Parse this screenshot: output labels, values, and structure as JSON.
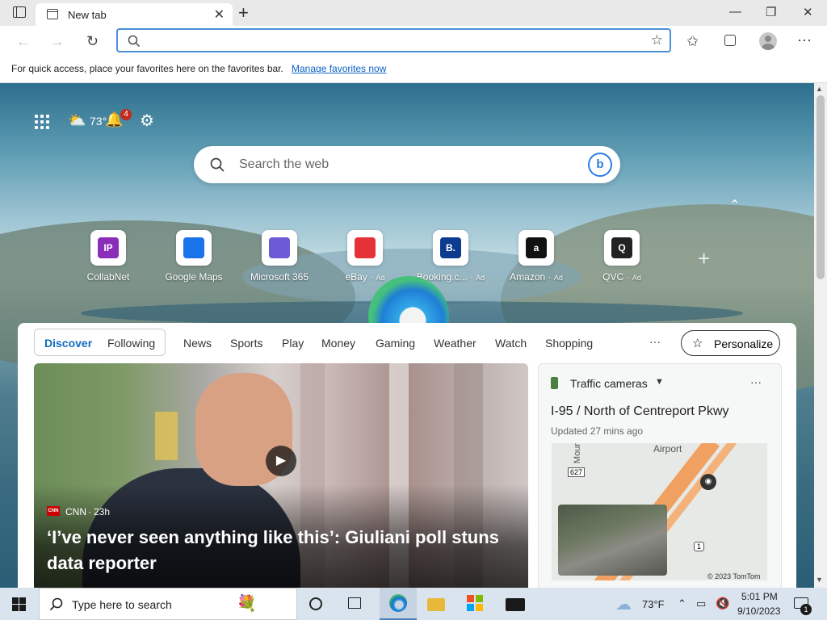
{
  "browser": {
    "tab_title": "New tab",
    "new_tab_symbol": "+",
    "window_controls": {
      "minimize": "—",
      "maximize": "❐",
      "close": "✕"
    },
    "favbar_message": "For quick access, place your favorites here on the favorites bar.",
    "favbar_link": "Manage favorites now"
  },
  "newtab": {
    "weather_temp": "73°",
    "notification_count": "4",
    "search_placeholder": "Search the web",
    "quick_links": [
      {
        "label": "CollabNet",
        "ad": "",
        "icon": "IP",
        "color": "#8a2db8"
      },
      {
        "label": "Google Maps",
        "ad": "",
        "icon": "map-pin",
        "color": "#1a73e8"
      },
      {
        "label": "Microsoft 365",
        "ad": "",
        "icon": "m365",
        "color": "#6b5bd6"
      },
      {
        "label": "eBay",
        "ad": "Ad",
        "icon": "ebay-bag",
        "color": "#e53238"
      },
      {
        "label": "Booking.c...",
        "ad": "Ad",
        "icon": "B.",
        "color": "#0c3b8f"
      },
      {
        "label": "Amazon",
        "ad": "Ad",
        "icon": "a",
        "color": "#111111"
      },
      {
        "label": "QVC",
        "ad": "Ad",
        "icon": "Q",
        "color": "#222222"
      }
    ],
    "add_symbol": "+",
    "collapse_symbol": "⌃"
  },
  "feed": {
    "tabs": [
      "Discover",
      "Following"
    ],
    "nav": [
      "News",
      "Sports",
      "Play",
      "Money",
      "Gaming",
      "Weather",
      "Watch",
      "Shopping"
    ],
    "more": "···",
    "personalize": "Personalize",
    "hero": {
      "source": "CNN",
      "source_logo": "CNN",
      "age": "23h",
      "headline": "‘I’ve never seen anything like this’: Giuliani poll stuns data reporter"
    },
    "traffic": {
      "title": "Traffic cameras",
      "more": "···",
      "road": "I-95 / North of Centreport Pkwy",
      "updated": "Updated 27 mins ago",
      "map_label_airport": "Airport",
      "map_label_road": "Mour",
      "shield_1": "627",
      "shield_2": "1",
      "copyright": "© 2023 TomTom"
    }
  },
  "taskbar": {
    "search_placeholder": "Type here to search",
    "weather": "73°F",
    "time": "5:01 PM",
    "date": "9/10/2023",
    "notif_count": "1"
  },
  "colors": {
    "accent": "#0b62c4",
    "discover": "#0f6cbd"
  }
}
